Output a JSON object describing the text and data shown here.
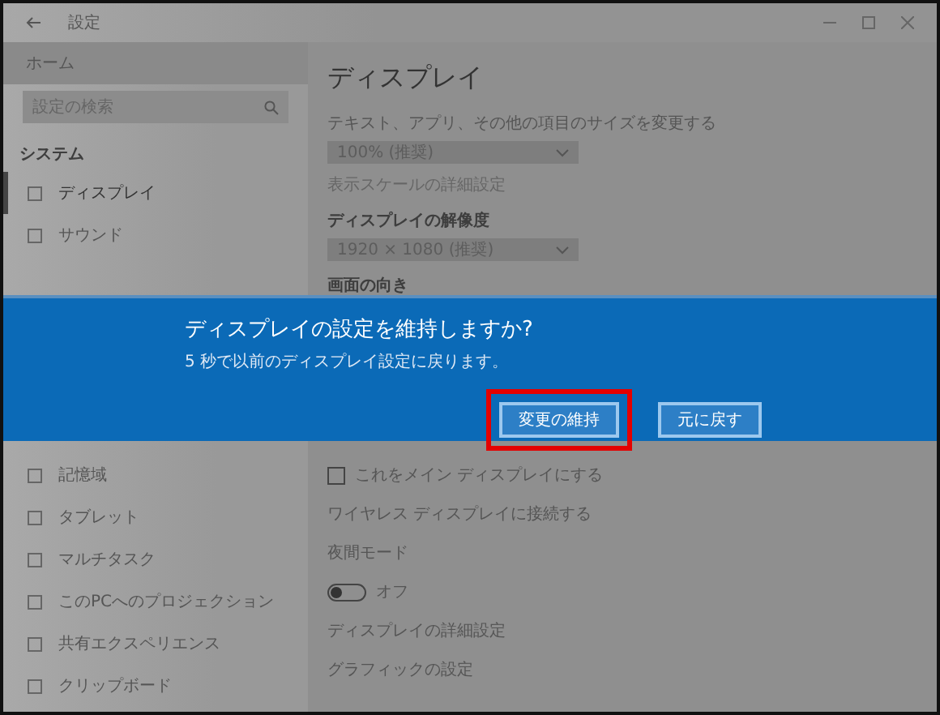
{
  "window": {
    "title": "設定"
  },
  "sidebar": {
    "home": "ホーム",
    "search": {
      "placeholder": "設定の検索"
    },
    "section": "システム",
    "upper_items": [
      {
        "label": "ディスプレイ",
        "selected": true
      },
      {
        "label": "サウンド",
        "selected": false
      }
    ],
    "lower_items": [
      {
        "label": "記憶域",
        "selected": false
      },
      {
        "label": "タブレット",
        "selected": false
      },
      {
        "label": "マルチタスク",
        "selected": false
      },
      {
        "label": "このPCへのプロジェクション",
        "selected": false
      },
      {
        "label": "共有エクスペリエンス",
        "selected": false
      },
      {
        "label": "クリップボード",
        "selected": false
      }
    ]
  },
  "main": {
    "title": "ディスプレイ",
    "upper": [
      {
        "kind": "label",
        "text": "テキスト、アプリ、その他の項目のサイズを変更する"
      },
      {
        "kind": "dropdown",
        "text": "100% (推奨)"
      },
      {
        "kind": "link",
        "text": "表示スケールの詳細設定"
      },
      {
        "kind": "heading",
        "text": "ディスプレイの解像度"
      },
      {
        "kind": "dropdown",
        "text": "1920 × 1080 (推奨)"
      },
      {
        "kind": "heading",
        "text": "画面の向き"
      }
    ],
    "lower": [
      {
        "kind": "checkbox",
        "text": "これをメイン ディスプレイにする",
        "checked": false
      },
      {
        "kind": "label",
        "text": "ワイヤレス ディスプレイに接続する"
      },
      {
        "kind": "label",
        "text": "夜間モード"
      },
      {
        "kind": "toggle",
        "text": "オフ",
        "on": false
      },
      {
        "kind": "label",
        "text": "ディスプレイの詳細設定"
      },
      {
        "kind": "label",
        "text": "グラフィックの設定"
      }
    ]
  },
  "dialog": {
    "title": "ディスプレイの設定を維持しますか?",
    "message": "5 秒で以前のディスプレイ設定に戻ります。",
    "buttons": [
      {
        "label": "変更の維持",
        "highlighted": true
      },
      {
        "label": "元に戻す",
        "highlighted": false
      }
    ]
  }
}
